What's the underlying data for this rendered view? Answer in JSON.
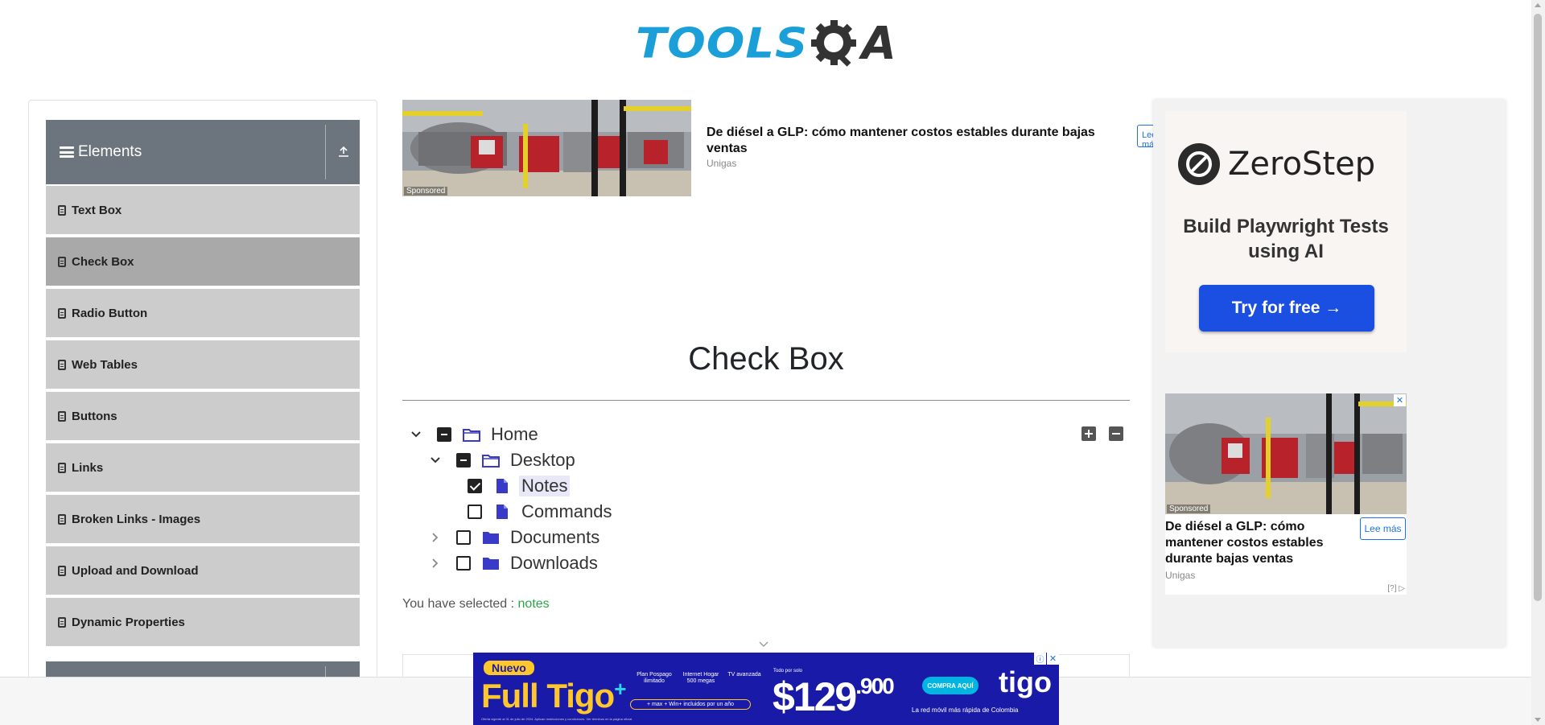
{
  "header": {
    "logo_text_left": "TOOLS",
    "logo_text_right": "A"
  },
  "sidebar": {
    "group_title": "Elements",
    "items": [
      {
        "label": "Text Box"
      },
      {
        "label": "Check Box"
      },
      {
        "label": "Radio Button"
      },
      {
        "label": "Web Tables"
      },
      {
        "label": "Buttons"
      },
      {
        "label": "Links"
      },
      {
        "label": "Broken Links - Images"
      },
      {
        "label": "Upload and Download"
      },
      {
        "label": "Dynamic Properties"
      }
    ],
    "active_index": 1
  },
  "top_ad": {
    "sponsored": "Sponsored",
    "headline": "De diésel a GLP: cómo mantener costos estables durante bajas ventas",
    "source": "Unigas",
    "button": "Lee más"
  },
  "main": {
    "title": "Check Box",
    "tree": [
      {
        "label": "Home",
        "state": "half",
        "expanded": true,
        "icon": "folder-open-icon"
      },
      {
        "label": "Desktop",
        "state": "half",
        "expanded": true,
        "icon": "folder-open-icon"
      },
      {
        "label": "Notes",
        "state": "checked",
        "icon": "file-icon"
      },
      {
        "label": "Commands",
        "state": "unchecked",
        "icon": "file-icon"
      },
      {
        "label": "Documents",
        "state": "unchecked",
        "expanded": false,
        "icon": "folder-icon"
      },
      {
        "label": "Downloads",
        "state": "unchecked",
        "expanded": false,
        "icon": "folder-icon"
      }
    ],
    "selected_prefix": "You have selected :",
    "selected_value": "notes"
  },
  "right_ad": {
    "brand": "ZeroStep",
    "tagline": "Build Playwright Tests using AI",
    "cta": "Try for free →",
    "ad2": {
      "sponsored": "Sponsored",
      "headline": "De diésel a GLP: cómo mantener costos estables durante bajas ventas",
      "source": "Unigas",
      "button": "Lee más",
      "adchoice": "[?]"
    }
  },
  "banner": {
    "badge": "Nuevo",
    "brand": "Full Tigo",
    "feat1": "Plan Pospago ilimitado",
    "feat2": "Internet Hogar 500 megas",
    "feat3": "TV avanzada",
    "pill": "+ max + Win+ incluidos por un año",
    "todo": "Todo por solo",
    "price": "$129",
    "price_cents": ".900",
    "cta": "COMPRA AQUÍ",
    "logo": "tigo",
    "tag": "La red móvil más rápida de Colombia",
    "legal": "Oferta vigente al 31 de julio de 2024. Aplican restricciones y condiciones. Ver términos en la página oficial."
  },
  "colors": {
    "logo_blue": "#1a9fd8",
    "sidebar_header": "#6c757d",
    "sidebar_item": "#cccccc",
    "sidebar_active": "#a9a9a9",
    "selected_value": "#28a745",
    "zerostep_button": "#1b4fe2",
    "banner_bg": "#1a1aa8"
  }
}
